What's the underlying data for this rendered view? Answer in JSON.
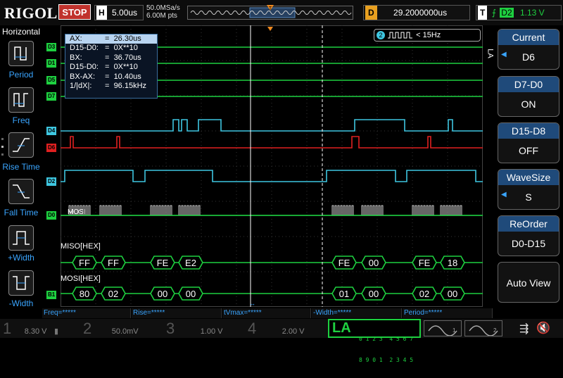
{
  "topbar": {
    "logo": "RIGOL",
    "run_state": "STOP",
    "h_label": "H",
    "timebase": "5.00us",
    "sample_rate": "50.0MSa/s",
    "memory_depth": "6.00M pts",
    "delay_label": "D",
    "delay": "29.2000000us",
    "trigger_label": "T",
    "trigger_source": "D2",
    "trigger_level": "1.13 V"
  },
  "left_panel": {
    "title": "Horizontal",
    "buttons": [
      {
        "label": "Period",
        "icon": "period-icon"
      },
      {
        "label": "Freq",
        "icon": "frequency-icon"
      },
      {
        "label": "Rise Time",
        "icon": "rise-time-icon"
      },
      {
        "label": "Fall Time",
        "icon": "fall-time-icon"
      },
      {
        "label": "+Width",
        "icon": "positive-width-icon"
      },
      {
        "label": "-Width",
        "icon": "negative-width-icon"
      }
    ]
  },
  "right_panel": {
    "side_label": "LA",
    "buttons": [
      {
        "title": "Current",
        "value": "D6",
        "has_arrow": true
      },
      {
        "title": "D7-D0",
        "value": "ON",
        "has_arrow": false
      },
      {
        "title": "D15-D8",
        "value": "OFF",
        "has_arrow": false
      },
      {
        "title": "WaveSize",
        "value": "S",
        "has_arrow": true
      },
      {
        "title": "ReOrder",
        "value": "D0-D15",
        "has_arrow": false
      },
      {
        "title": "",
        "value": "Auto View",
        "has_arrow": false
      }
    ]
  },
  "cursor_measure": {
    "rows": [
      {
        "k": "AX:",
        "eq": "=",
        "v": "26.30us"
      },
      {
        "k": "D15-D0:",
        "eq": "=",
        "v": "0X**10"
      },
      {
        "k": "BX:",
        "eq": "=",
        "v": "36.70us"
      },
      {
        "k": "D15-D0:",
        "eq": "=",
        "v": "0X**10"
      },
      {
        "k": "BX-AX:",
        "eq": "=",
        "v": "10.40us"
      },
      {
        "k": "1/|dX|:",
        "eq": "=",
        "v": "96.15kHz"
      }
    ]
  },
  "frequency_counter": {
    "channel": "2",
    "value": "< 15Hz"
  },
  "channels": {
    "labels": [
      "D3",
      "D1",
      "D5",
      "D7",
      "D4",
      "D6",
      "D2",
      "D0"
    ],
    "colors": {
      "green": "#1ed040",
      "cyan": "#3ec6e0",
      "red": "#e02020"
    }
  },
  "decode": {
    "bus1_label": "MISO[HEX]",
    "bus1_marker": "B1",
    "bus2_label": "MOSI[HEX]",
    "mosi_text": "MOSI",
    "miso_values": [
      "FF",
      "FF",
      "FE",
      "E2",
      "FE",
      "00",
      "FE",
      "18"
    ],
    "mosi_values": [
      "80",
      "02",
      "00",
      "00",
      "01",
      "00",
      "02",
      "00"
    ]
  },
  "measure_bar": {
    "freq": "Freq=*****",
    "rise": "Rise=*****",
    "tvmax": "tVmax=*****",
    "neg_width": "-Width=*****",
    "period": "Period=*****"
  },
  "status_bar": {
    "ch1_num": "1",
    "ch1_val": "8.30 V",
    "ch2_num": "2",
    "ch2_val": "50.0mV",
    "ch3_num": "3",
    "ch3_val": "1.00 V",
    "ch4_num": "4",
    "ch4_val": "2.00 V",
    "la_label": "LA",
    "la_bits_top": "0 1 2 3  4 5 6 7",
    "la_bits_bottom": "8 9 0 1  2 3 4 5",
    "gen1_label": "1",
    "gen2_label": "2"
  }
}
